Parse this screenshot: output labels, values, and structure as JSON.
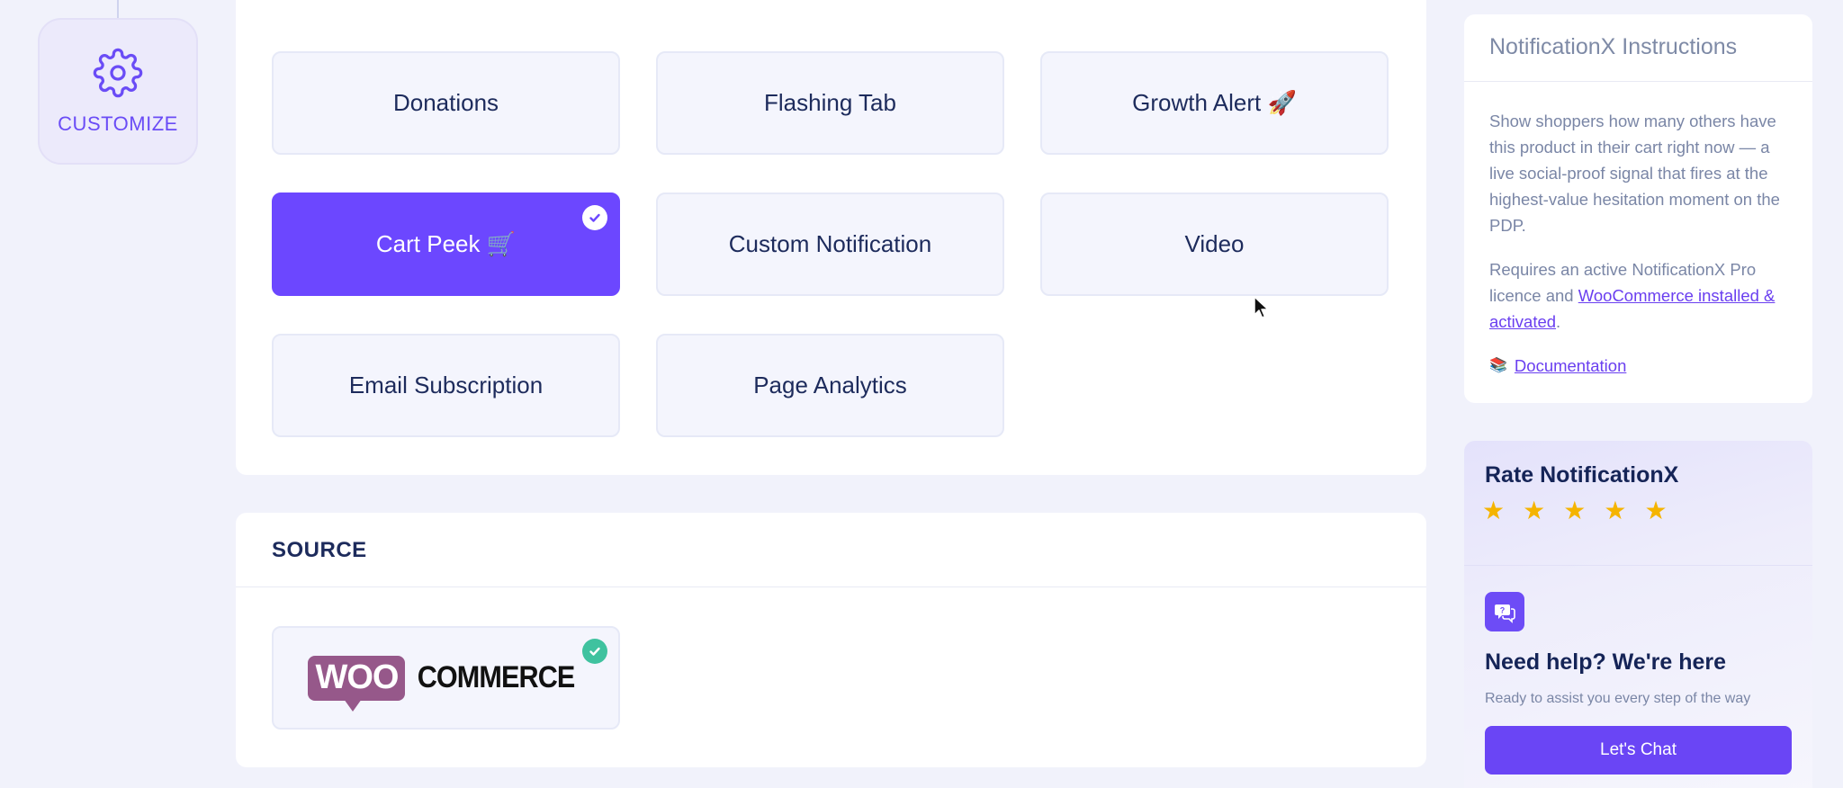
{
  "sidebar": {
    "step_label": "CUSTOMIZE",
    "step_icon": "gear-icon"
  },
  "notification_types": [
    {
      "label": "",
      "selected": false
    },
    {
      "label": "",
      "selected": false
    },
    {
      "label": "",
      "selected": false
    },
    {
      "label": "Donations",
      "selected": false
    },
    {
      "label": "Flashing Tab",
      "selected": false
    },
    {
      "label": "Growth Alert 🚀",
      "selected": false
    },
    {
      "label": "Cart Peek 🛒",
      "selected": true
    },
    {
      "label": "Custom Notification",
      "selected": false
    },
    {
      "label": "Video",
      "selected": false
    },
    {
      "label": "Email Subscription",
      "selected": false
    },
    {
      "label": "Page Analytics",
      "selected": false
    }
  ],
  "source": {
    "title": "SOURCE",
    "provider": {
      "name": "WooCommerce",
      "logo_left": "WOO",
      "logo_right": "COMMERCE",
      "selected": true
    }
  },
  "instructions": {
    "title": "NotificationX Instructions",
    "paragraph1": "Show shoppers how many others have this product in their cart right now — a live social-proof signal that fires at the highest-value hesitation moment on the PDP.",
    "paragraph2_before": "Requires an active NotificationX Pro licence and ",
    "paragraph2_link": "WooCommerce installed & activated",
    "paragraph2_after": ".",
    "doc_icon": "📚",
    "doc_link": "Documentation"
  },
  "rating": {
    "title": "Rate NotificationX",
    "stars": 5
  },
  "help": {
    "title": "Need help? We're here",
    "subtitle": "Ready to assist you every step of the way",
    "button": "Let's Chat"
  },
  "colors": {
    "accent": "#6c47ff",
    "woo_purple": "#96588a",
    "success": "#3fc29f",
    "star": "#f5b400"
  }
}
